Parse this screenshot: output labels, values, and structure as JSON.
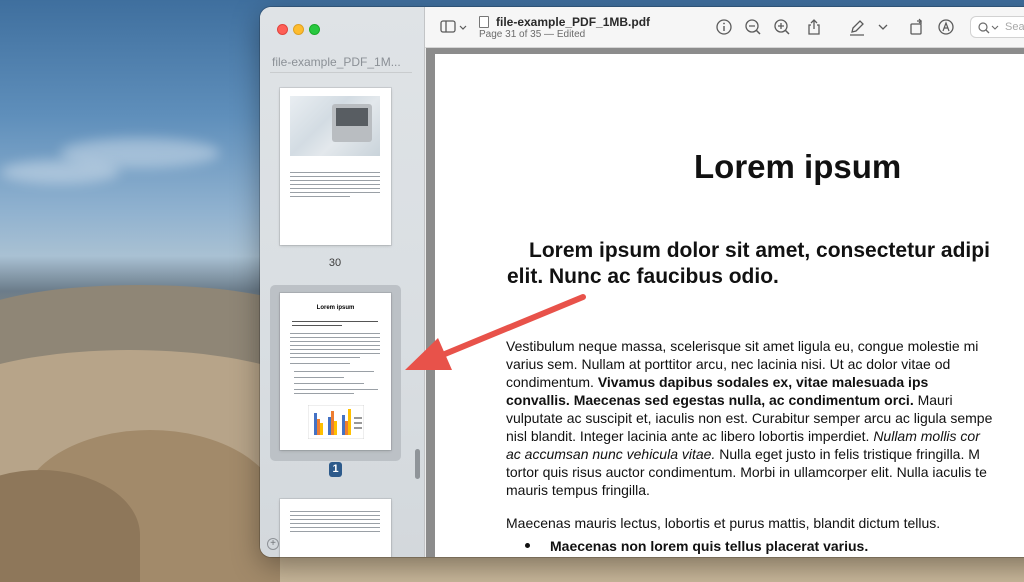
{
  "window": {
    "sidebar_title": "file-example_PDF_1M...",
    "doc_title": "file-example_PDF_1MB.pdf",
    "doc_subtitle": "Page 31 of 35 — Edited",
    "search_placeholder": "Search"
  },
  "thumbnails": [
    {
      "page_label": "30",
      "selected": false
    },
    {
      "page_label": "1",
      "selected": true
    },
    {
      "page_label": "",
      "selected": false
    }
  ],
  "thumbnail_text": {
    "page31_heading": "Lorem ipsum"
  },
  "document": {
    "heading": "Lorem ipsum",
    "subheading_line1": "Lorem ipsum dolor sit amet, consectetur adipi",
    "subheading_line2": "elit. Nunc ac faucibus odio.",
    "p1": [
      "Vestibulum neque massa, scelerisque sit amet ligula eu, congue molestie mi",
      "varius sem. Nullam at porttitor arcu, nec lacinia nisi. Ut ac dolor vitae od",
      [
        "condimentum. ",
        "Vivamus dapibus sodales ex, vitae malesuada ips"
      ],
      [
        "convallis. Maecenas sed egestas nulla, ac condimentum orci.",
        " Mauri"
      ],
      "vulputate ac suscipit et, iaculis non est. Curabitur semper arcu ac ligula sempe",
      [
        "nisl blandit. Integer lacinia ante ac libero lobortis imperdiet. ",
        "Nullam mollis cor"
      ],
      [
        "ac accumsan nunc vehicula vitae.",
        " Nulla eget justo in felis tristique fringilla. M"
      ],
      "tortor quis risus auctor condimentum. Morbi in ullamcorper elit. Nulla iaculis te",
      "mauris tempus fringilla."
    ],
    "p2": "Maecenas mauris lectus, lobortis et purus mattis, blandit dictum tellus.",
    "bullet1": "Maecenas non lorem quis tellus placerat varius."
  },
  "icons": {
    "sidebar_toggle": "sidebar-icon",
    "info": "info-icon",
    "zoom_out": "zoom-out-icon",
    "zoom_in": "zoom-in-icon",
    "share": "share-icon",
    "markup": "pen-icon",
    "rotate": "rotate-icon",
    "annotate": "annotate-icon",
    "search": "search-icon"
  },
  "colors": {
    "arrow": "#e8524a",
    "selected_badge": "#2d5a8b"
  }
}
